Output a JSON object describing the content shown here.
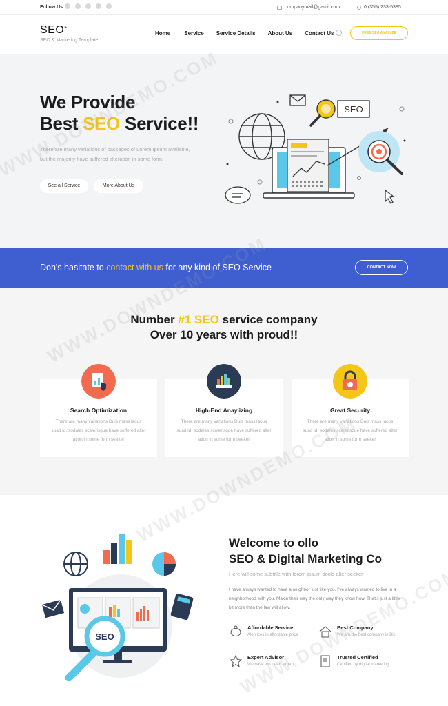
{
  "topbar": {
    "follow_label": "Follow Us",
    "social_icons": [
      "facebook-icon",
      "twitter-icon",
      "linkedin-icon",
      "vimeo-icon",
      "pinterest-icon"
    ],
    "email": "companymail@gamil.com",
    "phone": "0 (355) 233-5385"
  },
  "header": {
    "logo": "SEO",
    "logo_mark": "+",
    "tagline": "SEO & Marketing Template",
    "nav": [
      "Home",
      "Service",
      "Service Details",
      "About Us",
      "Contact Us"
    ],
    "cta_label": "FREE SEO ANALYZE"
  },
  "hero": {
    "title_line1": "We Provide",
    "title_pre": "Best ",
    "title_highlight": "SEO",
    "title_post": " Service!!",
    "lead": "There are many variations of passages of Lorem Ipsum available, but the majority have suffered alteration in some form.",
    "btn_primary": "See all Service",
    "btn_secondary": "More About Us",
    "art_label": "SEO"
  },
  "cta": {
    "msg_pre": "Don's hasitate to ",
    "msg_highlight": "contact with us",
    "msg_post": " for any kind of SEO Service",
    "button": "CONTACT NOW"
  },
  "services": {
    "title_pre": "Number ",
    "title_highlight": "#1 SEO",
    "title_post": " service company",
    "title_line2": "Over 10 years with proud!!",
    "cards": [
      {
        "title": "Search Optimization",
        "desc": "There are many variations Duis mass lacus suad id, sodales scelerisque have suffered alter ation in some form seeker"
      },
      {
        "title": "High-End Anaylizing",
        "desc": "There are many variations Duis mass lacus suad id, sodales scelerisque have suffered alter ation in some form seeker"
      },
      {
        "title": "Great Security",
        "desc": "There are many variations Duis mass lacus suad id, sodales scelerisque have suffered alter ation in some form seeker"
      }
    ],
    "colors": [
      "#f26b4f",
      "#2b3a55",
      "#f5c518"
    ]
  },
  "welcome": {
    "title_line1": "Welcome to ollo",
    "title_line2": "SEO & Digital Marketing Co",
    "subtitle": "Here will some subtitle with lorem ipsum dools alter seeker",
    "body": "I have always wanted to have a neighbor just like you. I've always wanted to live in a neighborhood with you. Makin their way the only way they know how. That's just a little bit more than the law will allow.",
    "art_label": "SEO",
    "features": [
      {
        "title": "Affordable Service",
        "desc": "Alervices in affordable price"
      },
      {
        "title": "Best Company",
        "desc": "We are the best company in Biz"
      },
      {
        "title": "Expert Advisor",
        "desc": "We have top rated expert"
      },
      {
        "title": "Trusted Certified",
        "desc": "Certified by digital marketing"
      }
    ]
  },
  "watermark": "WWW.DOWNDEMO.COM",
  "accent": "#f5c518",
  "brand_blue": "#3f5fd0"
}
